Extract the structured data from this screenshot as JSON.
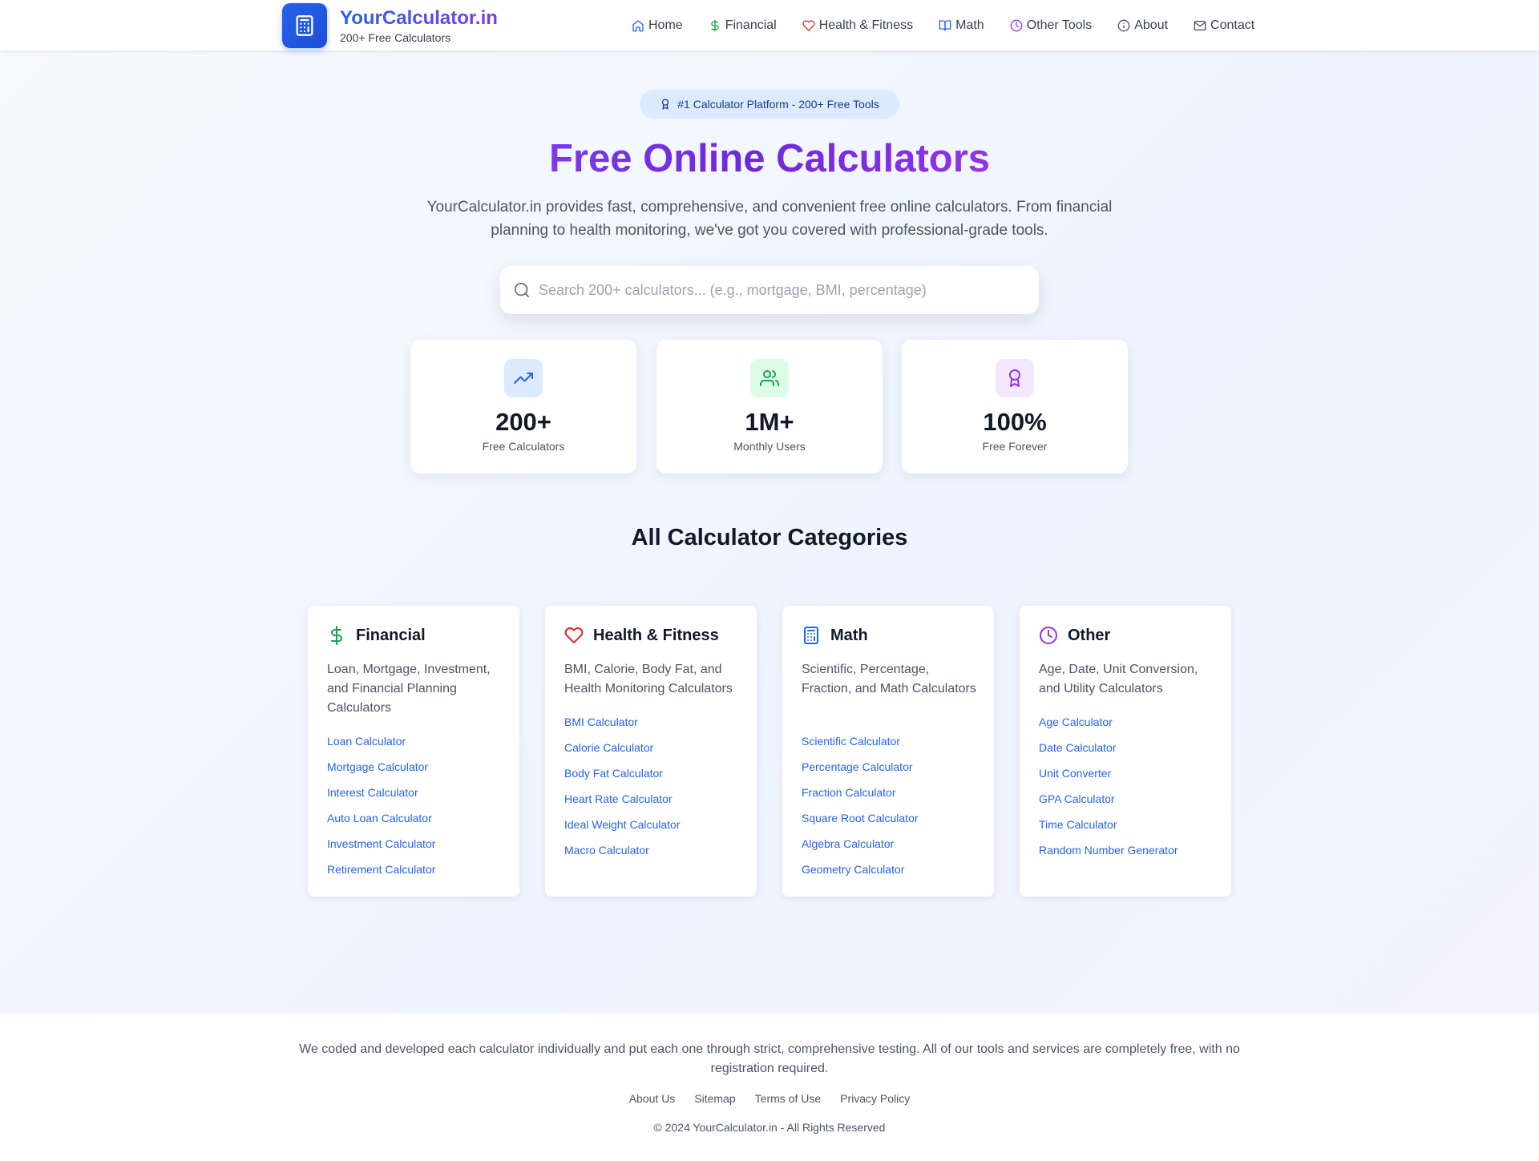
{
  "header": {
    "brand_title": "YourCalculator.in",
    "brand_subtitle": "200+ Free Calculators",
    "nav": [
      {
        "label": "Home",
        "icon": "home-icon",
        "color": "#2563eb"
      },
      {
        "label": "Financial",
        "icon": "dollar-icon",
        "color": "#16a34a"
      },
      {
        "label": "Health & Fitness",
        "icon": "heart-icon",
        "color": "#dc2626"
      },
      {
        "label": "Math",
        "icon": "book-icon",
        "color": "#2563eb"
      },
      {
        "label": "Other Tools",
        "icon": "clock-icon",
        "color": "#9333ea"
      },
      {
        "label": "About",
        "icon": "info-icon",
        "color": "#4b5563"
      },
      {
        "label": "Contact",
        "icon": "mail-icon",
        "color": "#4b5563"
      }
    ]
  },
  "hero": {
    "badge": "#1 Calculator Platform - 200+ Free Tools",
    "title": "Free Online Calculators",
    "description": "YourCalculator.in provides fast, comprehensive, and convenient free online calculators. From financial planning to health monitoring, we've got you covered with professional-grade tools.",
    "search_placeholder": "Search 200+ calculators... (e.g., mortgage, BMI, percentage)"
  },
  "stats": [
    {
      "value": "200+",
      "label": "Free Calculators",
      "icon": "trending-up-icon",
      "color": "#2563eb",
      "bg": "#dbeafe"
    },
    {
      "value": "1M+",
      "label": "Monthly Users",
      "icon": "users-icon",
      "color": "#16a34a",
      "bg": "#dcfce7"
    },
    {
      "value": "100%",
      "label": "Free Forever",
      "icon": "award-icon",
      "color": "#9333ea",
      "bg": "#f3e8ff"
    }
  ],
  "categories_title": "All Calculator Categories",
  "categories": [
    {
      "title": "Financial",
      "icon": "dollar-icon",
      "color": "#16a34a",
      "description": "Loan, Mortgage, Investment, and Financial Planning Calculators",
      "links": [
        "Loan Calculator",
        "Mortgage Calculator",
        "Interest Calculator",
        "Auto Loan Calculator",
        "Investment Calculator",
        "Retirement Calculator"
      ]
    },
    {
      "title": "Health & Fitness",
      "icon": "heart-icon",
      "color": "#dc2626",
      "description": "BMI, Calorie, Body Fat, and Health Monitoring Calculators",
      "links": [
        "BMI Calculator",
        "Calorie Calculator",
        "Body Fat Calculator",
        "Heart Rate Calculator",
        "Ideal Weight Calculator",
        "Macro Calculator"
      ]
    },
    {
      "title": "Math",
      "icon": "calculator-icon",
      "color": "#2563eb",
      "description": "Scientific, Percentage, Fraction, and Math Calculators",
      "links": [
        "Scientific Calculator",
        "Percentage Calculator",
        "Fraction Calculator",
        "Square Root Calculator",
        "Algebra Calculator",
        "Geometry Calculator"
      ]
    },
    {
      "title": "Other",
      "icon": "clock-icon",
      "color": "#9333ea",
      "description": "Age, Date, Unit Conversion, and Utility Calculators",
      "links": [
        "Age Calculator",
        "Date Calculator",
        "Unit Converter",
        "GPA Calculator",
        "Time Calculator",
        "Random Number Generator"
      ]
    }
  ],
  "footer": {
    "description": "We coded and developed each calculator individually and put each one through strict, comprehensive testing. All of our tools and services are completely free, with no registration required.",
    "links": [
      "About Us",
      "Sitemap",
      "Terms of Use",
      "Privacy Policy"
    ],
    "copyright": "© 2024 YourCalculator.in - All Rights Reserved"
  }
}
